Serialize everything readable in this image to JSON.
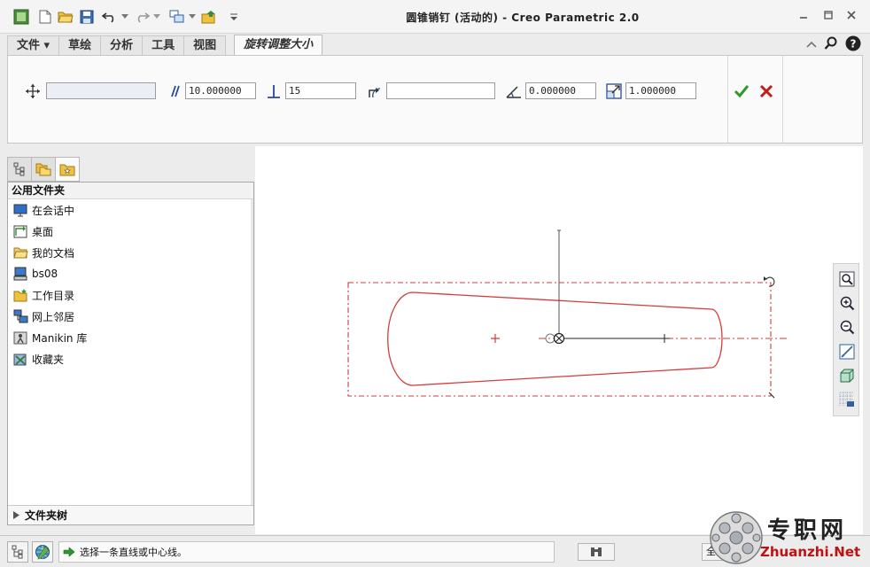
{
  "window": {
    "title": "圆锥销钉 (活动的) - Creo Parametric 2.0"
  },
  "ribbon": {
    "tabs": [
      {
        "label": "文件 ▾"
      },
      {
        "label": "草绘"
      },
      {
        "label": "分析"
      },
      {
        "label": "工具"
      },
      {
        "label": "视图"
      }
    ],
    "active_tab": "旋转调整大小"
  },
  "dashboard": {
    "reference_value": "",
    "parallel_offset": "10.000000",
    "normal_offset": "15",
    "rotation_reference": "",
    "angle_value": "0.000000",
    "scale_value": "1.000000"
  },
  "navigator": {
    "header": "公用文件夹",
    "items": [
      {
        "label": "在会话中",
        "icon": "monitor-icon"
      },
      {
        "label": "桌面",
        "icon": "desktop-icon"
      },
      {
        "label": "我的文档",
        "icon": "folder-open-icon"
      },
      {
        "label": "bs08",
        "icon": "computer-icon"
      },
      {
        "label": "工作目录",
        "icon": "working-folder-icon"
      },
      {
        "label": "网上邻居",
        "icon": "network-icon"
      },
      {
        "label": "Manikin 库",
        "icon": "manikin-icon"
      },
      {
        "label": "收藏夹",
        "icon": "favorites-icon"
      }
    ],
    "footer": "文件夹树"
  },
  "statusbar": {
    "message": "选择一条直线或中心线。",
    "right_label": "全"
  },
  "watermark": {
    "brand": "专职网",
    "url": "Zhuanzhi.Net"
  },
  "colors": {
    "sketch": "#d83a3a",
    "accept": "#2e9a2e",
    "cancel": "#c41a1a"
  }
}
